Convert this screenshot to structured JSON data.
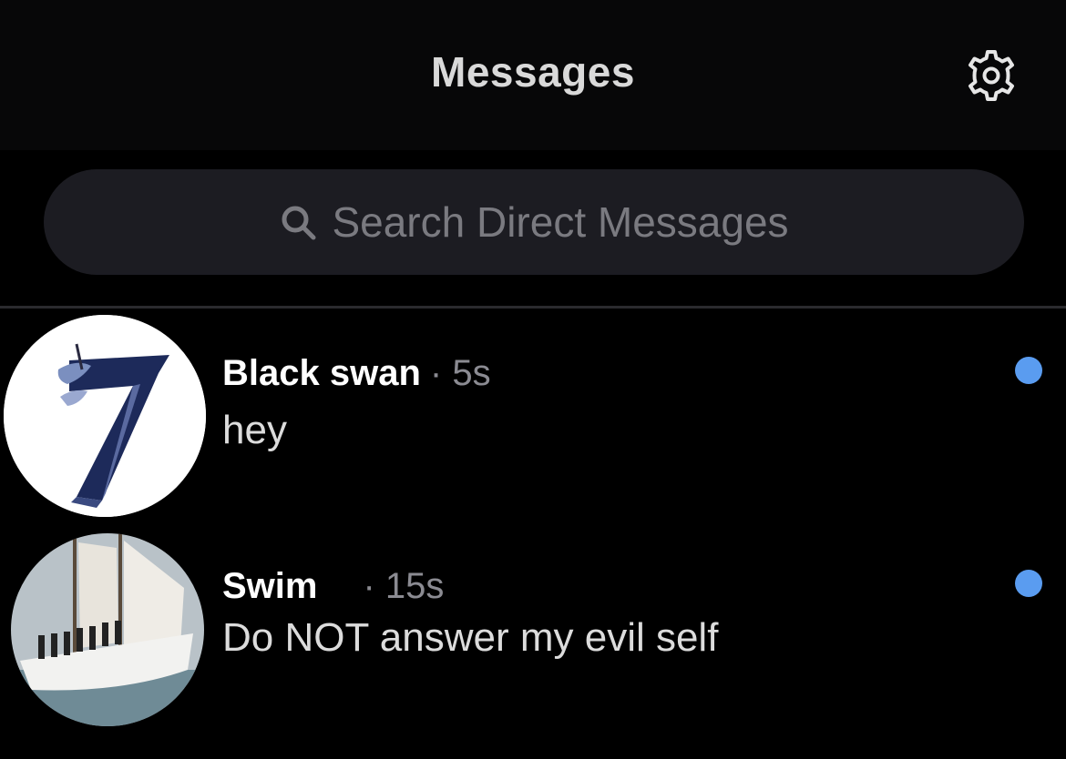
{
  "header": {
    "title": "Messages",
    "settings_icon": "gear-icon"
  },
  "search": {
    "placeholder": "Search Direct Messages",
    "icon": "search-icon"
  },
  "conversations": [
    {
      "name": "Black swan",
      "time": "· 5s",
      "preview": "hey",
      "unread": true,
      "avatar_icon": "seven-logo-avatar"
    },
    {
      "name": "Swim",
      "time": "· 15s",
      "preview": "Do NOT answer my evil self",
      "unread": true,
      "avatar_icon": "sailboat-photo-avatar"
    }
  ],
  "colors": {
    "background": "#000000",
    "unread_dot": "#5a9cf0",
    "search_bg": "#1c1c22"
  }
}
